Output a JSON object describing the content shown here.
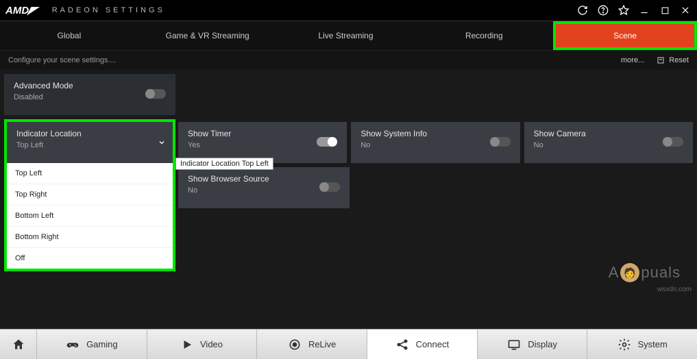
{
  "titlebar": {
    "brand": "AMD",
    "app_title": "RADEON SETTINGS"
  },
  "toptabs": {
    "items": [
      {
        "label": "Global"
      },
      {
        "label": "Game & VR Streaming"
      },
      {
        "label": "Live Streaming"
      },
      {
        "label": "Recording"
      },
      {
        "label": "Scene"
      }
    ],
    "active_index": 4
  },
  "secondarybar": {
    "description": "Configure your scene settings....",
    "more_label": "more...",
    "reset_label": "Reset"
  },
  "advanced_mode": {
    "label": "Advanced Mode",
    "value": "Disabled",
    "on": false
  },
  "indicator_location": {
    "label": "Indicator Location",
    "value": "Top Left",
    "options": [
      "Top Left",
      "Top Right",
      "Bottom Left",
      "Bottom Right",
      "Off"
    ],
    "tooltip": "Indicator Location Top Left"
  },
  "cards_row": [
    {
      "label": "Show Timer",
      "value": "Yes",
      "on": true
    },
    {
      "label": "Show System Info",
      "value": "No",
      "on": false
    },
    {
      "label": "Show Camera",
      "value": "No",
      "on": false
    }
  ],
  "cards_row2": [
    {
      "label": "Show Browser Source",
      "value": "No",
      "on": false
    }
  ],
  "bottomnav": {
    "items": [
      {
        "label": "Gaming"
      },
      {
        "label": "Video"
      },
      {
        "label": "ReLive"
      },
      {
        "label": "Connect"
      },
      {
        "label": "Display"
      },
      {
        "label": "System"
      }
    ],
    "active_index": 3
  },
  "watermarks": {
    "site": "wsxdn.com",
    "brand_left": "A",
    "brand_right": "puals"
  }
}
